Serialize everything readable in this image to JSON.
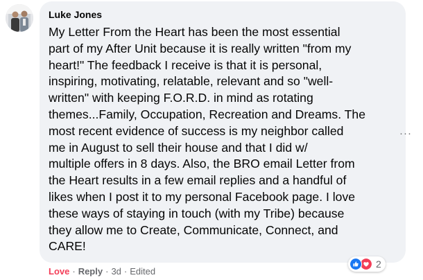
{
  "comment": {
    "author": "Luke Jones",
    "lines": [
      "My Letter From the Heart has been the most essential",
      "part of my After Unit because it is really written \"from my",
      "heart!\" The feedback I receive is that it is personal,",
      "inspiring, motivating, relatable, relevant and so \"well-",
      "written\" with keeping F.O.R.D. in mind as rotating",
      "themes...Family, Occupation, Recreation and Dreams. The",
      "most recent evidence of success is my neighbor called",
      "me in August to sell their house and that I did w/",
      "multiple offers in 8 days. Also, the BRO email Letter from",
      "the Heart results in a few email replies and a handful of",
      "likes when I post it to my personal Facebook page. I love",
      "these ways of staying in touch (with my Tribe) because",
      "they allow me to Create, Communicate, Connect, and",
      "CARE!"
    ]
  },
  "more_button": "···",
  "reactions": {
    "icons": [
      "like-icon",
      "love-icon"
    ],
    "count": "2"
  },
  "actions": {
    "love_label": "Love",
    "separator": "·",
    "reply_label": "Reply",
    "time": "3d",
    "edited": "Edited"
  },
  "colors": {
    "bubble": "#f0f2f5",
    "love_red": "#f33e58",
    "like_blue": "#1877f2",
    "muted": "#65676b"
  }
}
